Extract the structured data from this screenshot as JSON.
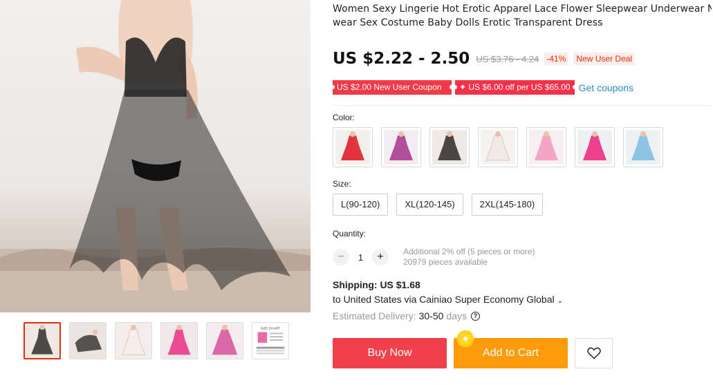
{
  "product": {
    "title": "Women Sexy Lingerie Hot Erotic Apparel Lace Flower Sleepwear Underwear Night",
    "title_line2": "wear Sex Costume Baby Dolls Erotic Transparent Dress"
  },
  "gallery": {
    "main_image_icon": "lingerie-photo",
    "thumbnails": [
      {
        "name": "black-dress-front"
      },
      {
        "name": "black-dress-reclining"
      },
      {
        "name": "white-dress"
      },
      {
        "name": "pink-dress"
      },
      {
        "name": "rose-dress"
      },
      {
        "name": "size-chart",
        "label": "SIZE CHART"
      }
    ]
  },
  "pricing": {
    "price": "US $2.22 - 2.50",
    "original_price": "US $3.76 - 4.24",
    "discount": "-41%",
    "deal_label": "New User Deal"
  },
  "coupons": {
    "new_user": "US $2.00 New User Coupon",
    "store": "✦ US $6.00 off per US $65.00",
    "get_label": "Get coupons"
  },
  "variants": {
    "color_label": "Color:",
    "colors": [
      {
        "name": "red",
        "hex": "#e0353d"
      },
      {
        "name": "purple",
        "hex": "#b24f9a"
      },
      {
        "name": "black",
        "hex": "#2a2a2a"
      },
      {
        "name": "white",
        "hex": "#f1e9e4"
      },
      {
        "name": "pink",
        "hex": "#f2a6c4"
      },
      {
        "name": "hot-pink",
        "hex": "#ec3f8c"
      },
      {
        "name": "blue",
        "hex": "#8fc4e6"
      }
    ],
    "size_label": "Size:",
    "sizes": [
      "L(90-120)",
      "XL(120-145)",
      "2XL(145-180)"
    ]
  },
  "quantity": {
    "label": "Quantity:",
    "minus": "−",
    "plus": "+",
    "value": "1",
    "offer": "Additional 2% off (5 pieces or more)",
    "available": "20979 pieces available"
  },
  "shipping": {
    "label": "Shipping:",
    "price": "US $1.68",
    "destination": "to United States via Cainiao Super Economy Global",
    "chevron": "⌄",
    "delivery_label": "Estimated Delivery:",
    "delivery_value": "30-50",
    "delivery_unit": "days",
    "help": "?"
  },
  "actions": {
    "buy_now": "Buy Now",
    "add_to_cart": "Add to Cart",
    "wishlist_icon": "heart-icon"
  },
  "colors": {
    "accent_red": "#f0404a",
    "accent_orange": "#ff9b0a",
    "link_blue": "#2e8bd1"
  }
}
